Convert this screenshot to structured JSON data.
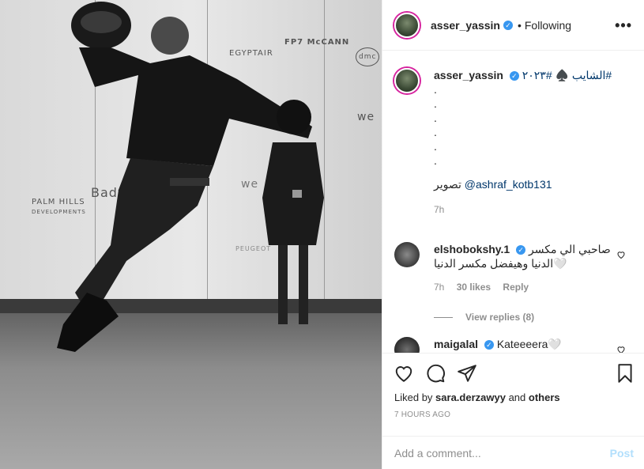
{
  "photo": {
    "logos": [
      "EGYPTAIR",
      "FP7 McCANN",
      "dmc",
      "we",
      "PALM HILLS",
      "DEVELOPMENTS",
      "Bady",
      "PEUGEOT"
    ]
  },
  "header": {
    "username": "asser_yassin",
    "follow_state": "Following",
    "verified_mark": "✓",
    "more": "•••"
  },
  "caption": {
    "username": "asser_yassin",
    "text": "الشايب ♠️ #٢٠٢٣#",
    "dots": [
      ".",
      ".",
      ".",
      ".",
      ".",
      "."
    ],
    "credit_prefix": "تصوير",
    "credit_mention": "@ashraf_kotb131",
    "time": "7h"
  },
  "comments": [
    {
      "username": "elshobokshy.1",
      "text": "صاحبي الي مكسر",
      "text2": "الدنيا وهيفضل مكسر الدنيا🤍",
      "time": "7h",
      "likes": "30 likes",
      "reply": "Reply",
      "view_replies": "View replies (8)"
    },
    {
      "username": "maigalal",
      "text": "Kateeeera🤍"
    }
  ],
  "actions": {
    "liked_prefix": "Liked by",
    "liked_user": "sara.derzawyy",
    "liked_and": "and",
    "liked_others": "others",
    "timestamp": "7 HOURS AGO",
    "add_comment_placeholder": "Add a comment...",
    "post_label": "Post"
  }
}
